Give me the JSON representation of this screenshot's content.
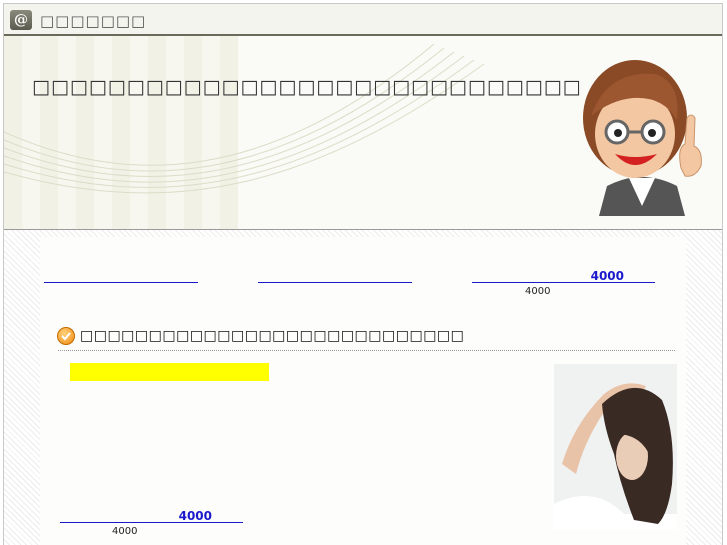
{
  "topbar": {
    "logo_char": "@",
    "site_name": "□□□□□□□"
  },
  "header": {
    "title": "□□□□□□□□□□□□□□□□□□□□□□□□□□□□□"
  },
  "links": [
    {
      "label": "",
      "sub": ""
    },
    {
      "label": "",
      "sub": ""
    },
    {
      "label": "4000",
      "sub": "4000"
    }
  ],
  "section": {
    "title": "□□□□□□□□□□□□□□□□□□□□□□□□□□□□",
    "link_label": "4000",
    "link_sub": "4000"
  },
  "colors": {
    "link": "#1a1acc",
    "highlight": "#ffff00",
    "accent": "#f08a12"
  },
  "icons": [
    "at-logo-icon",
    "check-circle-icon"
  ]
}
